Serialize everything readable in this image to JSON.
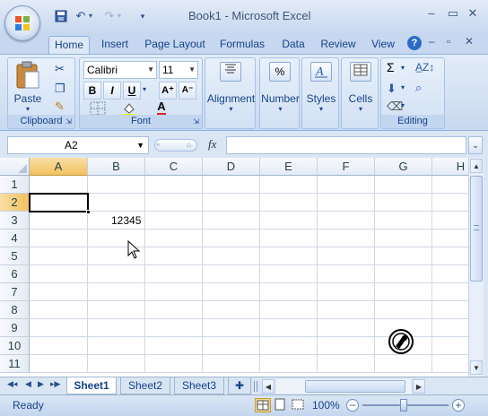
{
  "window": {
    "title": "Book1 - Microsoft Excel"
  },
  "ribbon_tabs": [
    "Home",
    "Insert",
    "Page Layout",
    "Formulas",
    "Data",
    "Review",
    "View"
  ],
  "clipboard": {
    "paste_label": "Paste",
    "group_label": "Clipboard"
  },
  "font": {
    "family": "Calibri",
    "size": "11",
    "group_label": "Font",
    "bold": "B",
    "italic": "I",
    "underline": "U"
  },
  "alignment": {
    "label": "Alignment"
  },
  "number": {
    "label": "Number",
    "icon_text": "%"
  },
  "styles": {
    "label": "Styles"
  },
  "cells": {
    "label": "Cells"
  },
  "editing": {
    "group_label": "Editing"
  },
  "formula_bar": {
    "name_box": "A2",
    "fx": "fx",
    "value": ""
  },
  "columns": [
    "A",
    "B",
    "C",
    "D",
    "E",
    "F",
    "G",
    "H"
  ],
  "rows": [
    "1",
    "2",
    "3",
    "4",
    "5",
    "6",
    "7",
    "8",
    "9",
    "10",
    "11"
  ],
  "cell_values": {
    "B3": "12345"
  },
  "active_cell": "A2",
  "sheets": [
    "Sheet1",
    "Sheet2",
    "Sheet3"
  ],
  "active_sheet": "Sheet1",
  "status": {
    "text": "Ready",
    "zoom": "100%"
  },
  "colors": {
    "ribbon_bg": "#dbe6f4",
    "selected_header": "#f1c15f",
    "grid_line": "#d0d7e5"
  }
}
